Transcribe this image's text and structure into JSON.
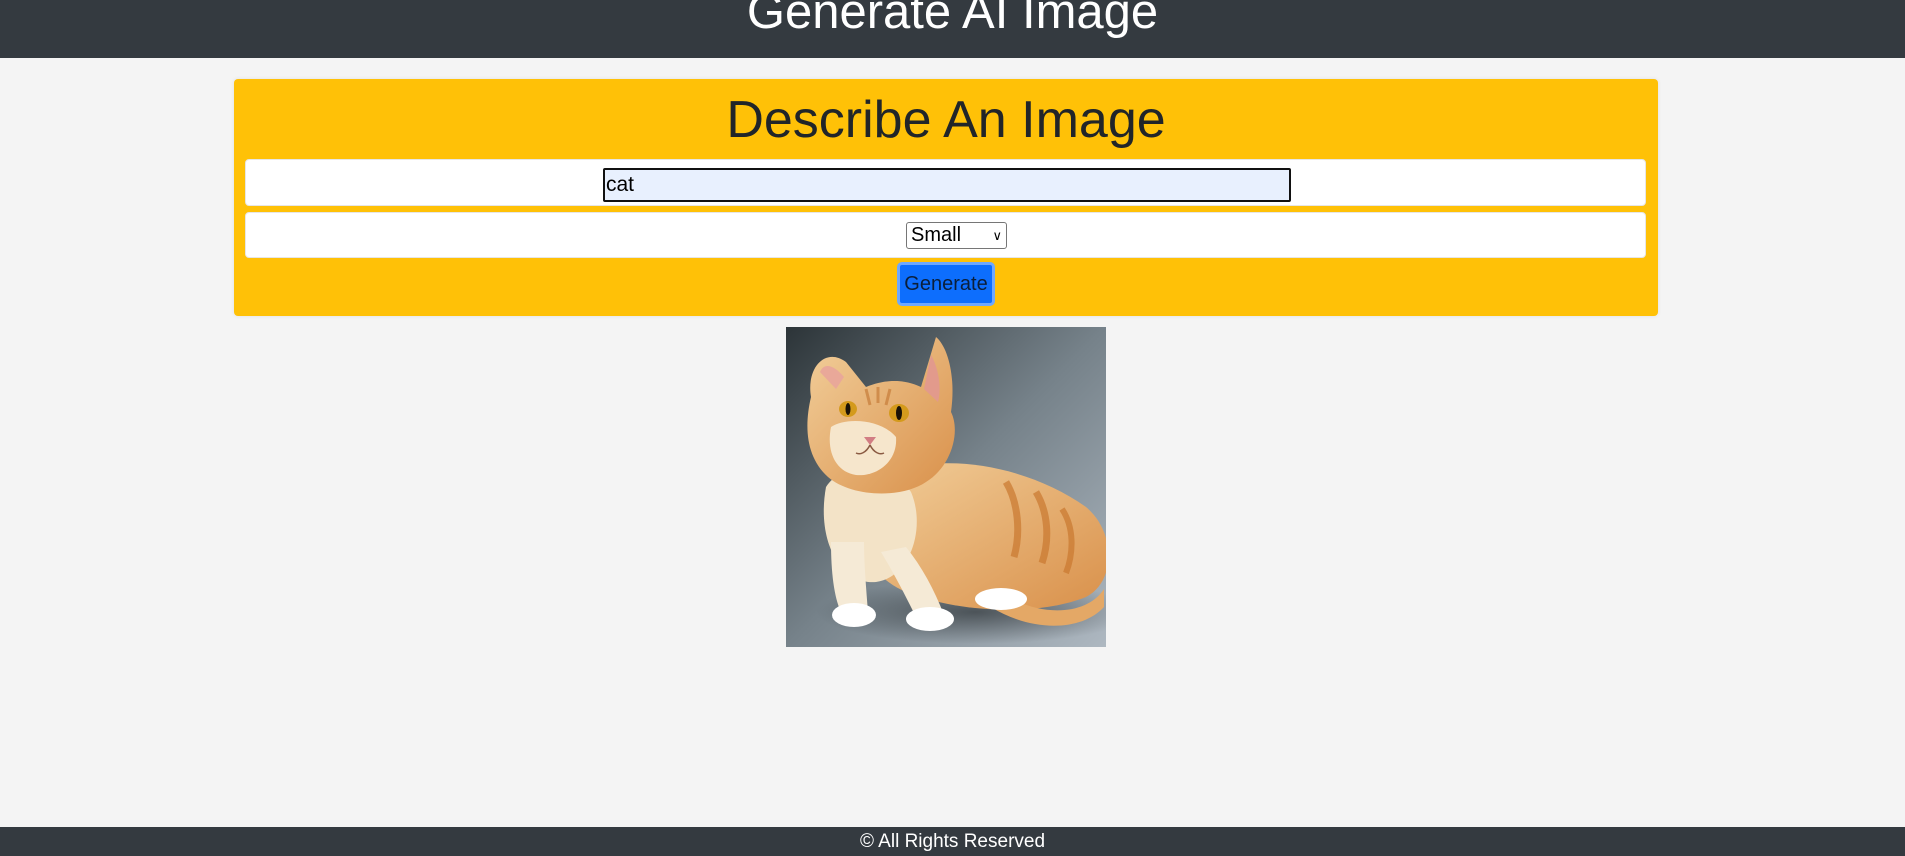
{
  "header": {
    "title": "Generate AI Image"
  },
  "form": {
    "heading": "Describe An Image",
    "prompt_value": "cat",
    "size_selected": "Small",
    "generate_label": "Generate"
  },
  "result": {
    "image_alt": "cat"
  },
  "footer": {
    "text": "© All Rights Reserved"
  },
  "colors": {
    "navbar": "#343a40",
    "card": "#ffc107",
    "button": "#0d6efd",
    "background": "#f4f4f4"
  }
}
